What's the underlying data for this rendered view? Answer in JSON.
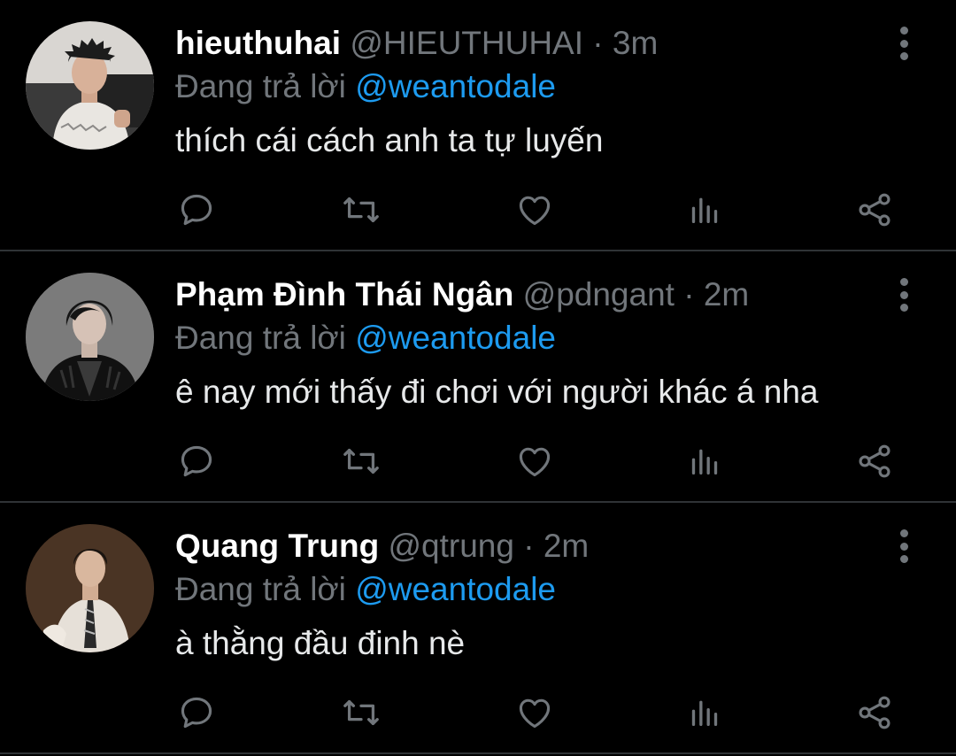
{
  "theme": {
    "background": "#000000",
    "divider": "#2f3336",
    "name_color": "#ffffff",
    "muted_color": "#71767b",
    "text_color": "#e7e9ea",
    "mention_color": "#1d9bf0"
  },
  "replies": [
    {
      "display_name": "hieuthuhai",
      "handle": "@HIEUTHUHAI",
      "separator": "·",
      "time": "3m",
      "reply_label": "Đang trả lời",
      "reply_to": "@weantodale",
      "text": "thích cái cách anh ta tự luyến",
      "avatar_icon": "avatar-photo"
    },
    {
      "display_name": "Phạm Đình Thái Ngân",
      "handle": "@pdngant",
      "separator": "·",
      "time": "2m",
      "reply_label": "Đang trả lời",
      "reply_to": "@weantodale",
      "text": "ê nay mới thấy đi chơi với người khác á nha",
      "avatar_icon": "avatar-photo"
    },
    {
      "display_name": "Quang Trung",
      "handle": "@qtrung",
      "separator": "·",
      "time": "2m",
      "reply_label": "Đang trả lời",
      "reply_to": "@weantodale",
      "text": "à thằng đầu đinh nè",
      "avatar_icon": "avatar-photo"
    }
  ],
  "action_icons": [
    "reply-icon",
    "retweet-icon",
    "like-icon",
    "views-icon",
    "share-icon"
  ],
  "more_icon": "more-vertical-icon"
}
